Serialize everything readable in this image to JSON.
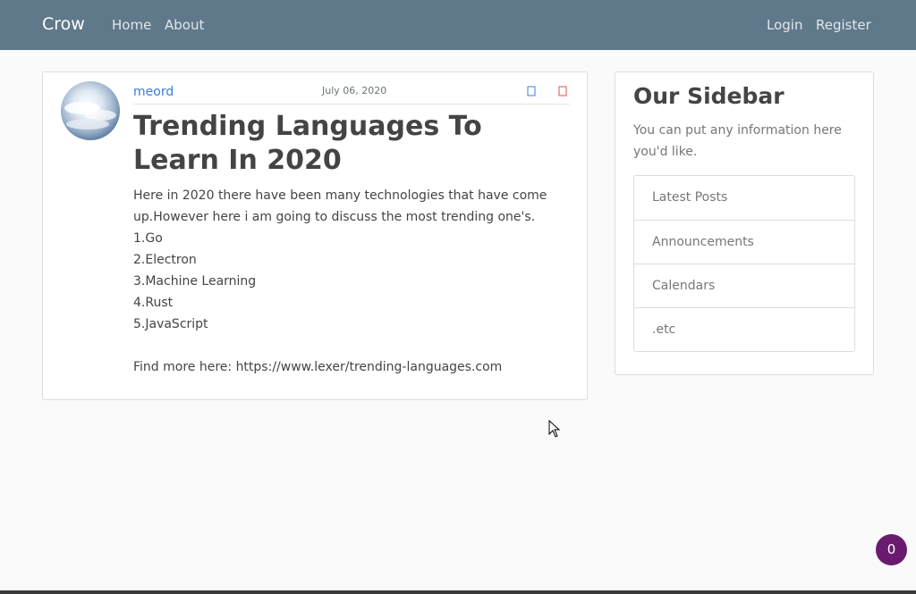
{
  "navbar": {
    "brand": "Crow",
    "links": [
      "Home",
      "About"
    ],
    "right_links": [
      "Login",
      "Register"
    ]
  },
  "post": {
    "author": "meord",
    "date": "July 06, 2020",
    "title": "Trending Languages To Learn In 2020",
    "body_lines": [
      "Here in 2020 there have been many technologies that have come",
      "up.However here i am going to discuss the most trending one's.",
      "1.Go",
      "2.Electron",
      "3.Machine Learning",
      "4.Rust",
      "5.JavaScript",
      "",
      "Find more here: https://www.lexer/trending-languages.com"
    ],
    "icons": {
      "edit": "edit-icon",
      "delete": "delete-icon"
    }
  },
  "sidebar": {
    "title": "Our Sidebar",
    "text": "You can put any information here you'd like.",
    "items": [
      "Latest Posts",
      "Announcements",
      "Calendars",
      ".etc"
    ]
  },
  "badge": {
    "count": "0"
  },
  "colors": {
    "navbar": "#5f788a",
    "link": "#3b7dd8",
    "badge": "#6a1b6e",
    "edit_icon": "#3b7dd8",
    "delete_icon": "#d9534f"
  }
}
